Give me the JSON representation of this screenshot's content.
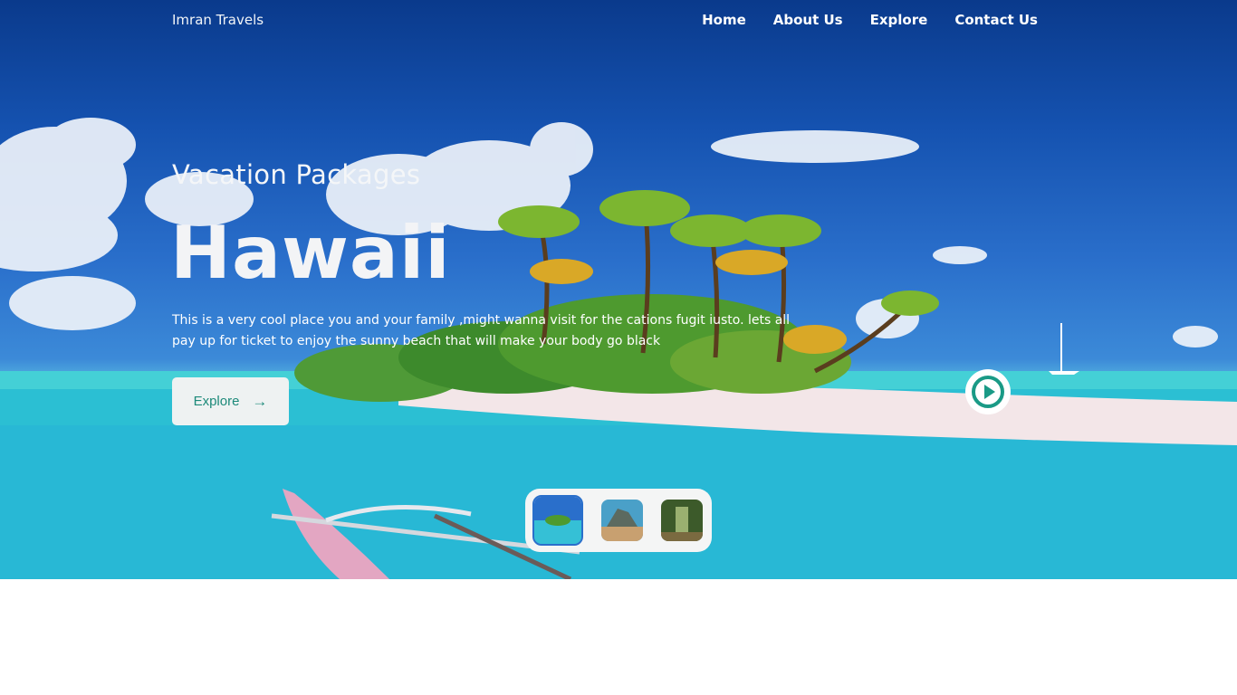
{
  "nav": {
    "brand": "Imran Travels",
    "links": [
      "Home",
      "About Us",
      "Explore",
      "Contact Us"
    ]
  },
  "hero": {
    "subtitle": "Vacation Packages",
    "title": "Hawaii",
    "description": "This is a very cool place you and your family ,might wanna visit for the cations fugit iusto. lets all pay up for ticket to enjoy the sunny beach that will make your body go black",
    "explore_label": "Explore",
    "explore_icon": "arrow-right-icon",
    "play_icon": "play-icon"
  },
  "gallery": {
    "thumbnails": [
      "island-thumbnail",
      "rock-thumbnail",
      "forest-thumbnail"
    ],
    "active_index": 0
  },
  "colors": {
    "accent": "#1d8a7a",
    "button_bg": "#eef2f2"
  }
}
